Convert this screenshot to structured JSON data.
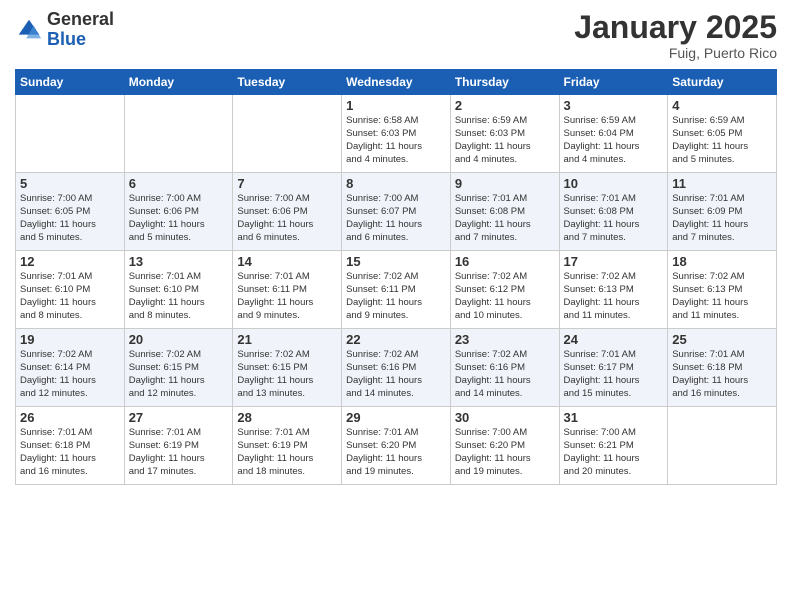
{
  "logo": {
    "general": "General",
    "blue": "Blue"
  },
  "header": {
    "month": "January 2025",
    "location": "Fuig, Puerto Rico"
  },
  "weekdays": [
    "Sunday",
    "Monday",
    "Tuesday",
    "Wednesday",
    "Thursday",
    "Friday",
    "Saturday"
  ],
  "weeks": [
    [
      {
        "day": "",
        "info": ""
      },
      {
        "day": "",
        "info": ""
      },
      {
        "day": "",
        "info": ""
      },
      {
        "day": "1",
        "info": "Sunrise: 6:58 AM\nSunset: 6:03 PM\nDaylight: 11 hours\nand 4 minutes."
      },
      {
        "day": "2",
        "info": "Sunrise: 6:59 AM\nSunset: 6:03 PM\nDaylight: 11 hours\nand 4 minutes."
      },
      {
        "day": "3",
        "info": "Sunrise: 6:59 AM\nSunset: 6:04 PM\nDaylight: 11 hours\nand 4 minutes."
      },
      {
        "day": "4",
        "info": "Sunrise: 6:59 AM\nSunset: 6:05 PM\nDaylight: 11 hours\nand 5 minutes."
      }
    ],
    [
      {
        "day": "5",
        "info": "Sunrise: 7:00 AM\nSunset: 6:05 PM\nDaylight: 11 hours\nand 5 minutes."
      },
      {
        "day": "6",
        "info": "Sunrise: 7:00 AM\nSunset: 6:06 PM\nDaylight: 11 hours\nand 5 minutes."
      },
      {
        "day": "7",
        "info": "Sunrise: 7:00 AM\nSunset: 6:06 PM\nDaylight: 11 hours\nand 6 minutes."
      },
      {
        "day": "8",
        "info": "Sunrise: 7:00 AM\nSunset: 6:07 PM\nDaylight: 11 hours\nand 6 minutes."
      },
      {
        "day": "9",
        "info": "Sunrise: 7:01 AM\nSunset: 6:08 PM\nDaylight: 11 hours\nand 7 minutes."
      },
      {
        "day": "10",
        "info": "Sunrise: 7:01 AM\nSunset: 6:08 PM\nDaylight: 11 hours\nand 7 minutes."
      },
      {
        "day": "11",
        "info": "Sunrise: 7:01 AM\nSunset: 6:09 PM\nDaylight: 11 hours\nand 7 minutes."
      }
    ],
    [
      {
        "day": "12",
        "info": "Sunrise: 7:01 AM\nSunset: 6:10 PM\nDaylight: 11 hours\nand 8 minutes."
      },
      {
        "day": "13",
        "info": "Sunrise: 7:01 AM\nSunset: 6:10 PM\nDaylight: 11 hours\nand 8 minutes."
      },
      {
        "day": "14",
        "info": "Sunrise: 7:01 AM\nSunset: 6:11 PM\nDaylight: 11 hours\nand 9 minutes."
      },
      {
        "day": "15",
        "info": "Sunrise: 7:02 AM\nSunset: 6:11 PM\nDaylight: 11 hours\nand 9 minutes."
      },
      {
        "day": "16",
        "info": "Sunrise: 7:02 AM\nSunset: 6:12 PM\nDaylight: 11 hours\nand 10 minutes."
      },
      {
        "day": "17",
        "info": "Sunrise: 7:02 AM\nSunset: 6:13 PM\nDaylight: 11 hours\nand 11 minutes."
      },
      {
        "day": "18",
        "info": "Sunrise: 7:02 AM\nSunset: 6:13 PM\nDaylight: 11 hours\nand 11 minutes."
      }
    ],
    [
      {
        "day": "19",
        "info": "Sunrise: 7:02 AM\nSunset: 6:14 PM\nDaylight: 11 hours\nand 12 minutes."
      },
      {
        "day": "20",
        "info": "Sunrise: 7:02 AM\nSunset: 6:15 PM\nDaylight: 11 hours\nand 12 minutes."
      },
      {
        "day": "21",
        "info": "Sunrise: 7:02 AM\nSunset: 6:15 PM\nDaylight: 11 hours\nand 13 minutes."
      },
      {
        "day": "22",
        "info": "Sunrise: 7:02 AM\nSunset: 6:16 PM\nDaylight: 11 hours\nand 14 minutes."
      },
      {
        "day": "23",
        "info": "Sunrise: 7:02 AM\nSunset: 6:16 PM\nDaylight: 11 hours\nand 14 minutes."
      },
      {
        "day": "24",
        "info": "Sunrise: 7:01 AM\nSunset: 6:17 PM\nDaylight: 11 hours\nand 15 minutes."
      },
      {
        "day": "25",
        "info": "Sunrise: 7:01 AM\nSunset: 6:18 PM\nDaylight: 11 hours\nand 16 minutes."
      }
    ],
    [
      {
        "day": "26",
        "info": "Sunrise: 7:01 AM\nSunset: 6:18 PM\nDaylight: 11 hours\nand 16 minutes."
      },
      {
        "day": "27",
        "info": "Sunrise: 7:01 AM\nSunset: 6:19 PM\nDaylight: 11 hours\nand 17 minutes."
      },
      {
        "day": "28",
        "info": "Sunrise: 7:01 AM\nSunset: 6:19 PM\nDaylight: 11 hours\nand 18 minutes."
      },
      {
        "day": "29",
        "info": "Sunrise: 7:01 AM\nSunset: 6:20 PM\nDaylight: 11 hours\nand 19 minutes."
      },
      {
        "day": "30",
        "info": "Sunrise: 7:00 AM\nSunset: 6:20 PM\nDaylight: 11 hours\nand 19 minutes."
      },
      {
        "day": "31",
        "info": "Sunrise: 7:00 AM\nSunset: 6:21 PM\nDaylight: 11 hours\nand 20 minutes."
      },
      {
        "day": "",
        "info": ""
      }
    ]
  ]
}
